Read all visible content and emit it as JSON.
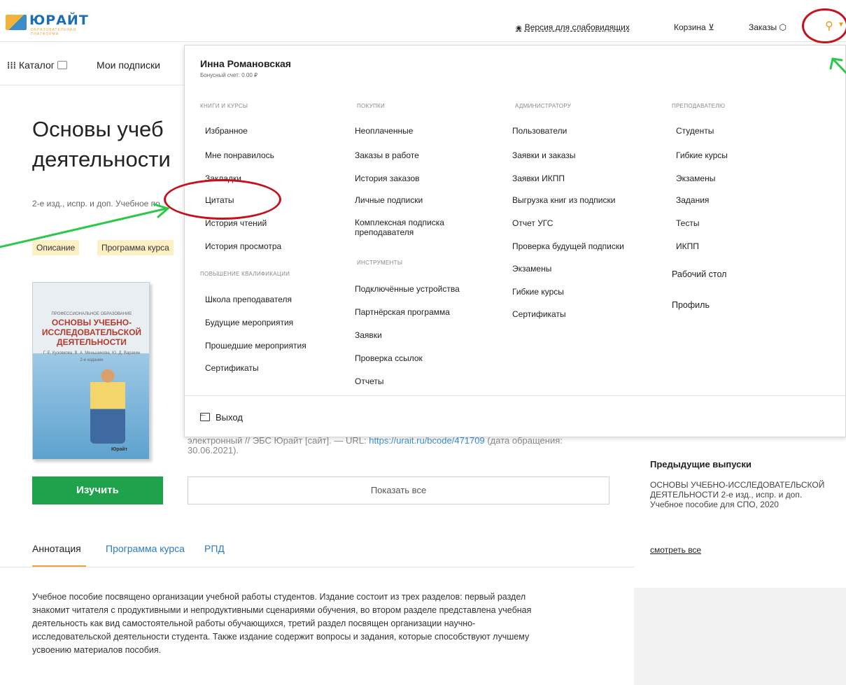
{
  "header": {
    "logo_text": "ЮРАЙТ",
    "logo_sub": "ОБРАЗОВАТЕЛЬНАЯ ПЛАТФОРМА",
    "accessible_version": "Версия для слабовидящих",
    "cart": "Корзина",
    "orders": "Заказы",
    "cart_icon": "🛒",
    "orders_icon": "⬡"
  },
  "nav": {
    "catalog": "Каталог",
    "subscriptions": "Мои подписки"
  },
  "book": {
    "title_line1": "Основы учеб",
    "title_line2": "деятельности",
    "edition": "2-е изд., испр. и доп. Учебное по",
    "tag_description": "Описание",
    "tag_program": "Программа курса",
    "cover_series": "ПРОФЕССИОНАЛЬНОЕ ОБРАЗОВАНИЕ",
    "cover_title": "ОСНОВЫ УЧЕБНО-ИССЛЕДОВАТЕЛЬСКОЙ ДЕЯТЕЛЬНОСТИ",
    "cover_authors": "Г. Е. Кузовкова, В. А. Меньшикова, Ю. Д. Варакин",
    "cover_edition": "2-е издание",
    "cover_publisher": "Юрайт",
    "citation_text": "электронный // ЭБС Юрайт [сайт]. — URL: ",
    "citation_url": "https://urait.ru/bcode/471709",
    "citation_tail": " (дата обращения: 30.06.2021).",
    "study_button": "Изучить",
    "show_all_button": "Показать все"
  },
  "tabs": {
    "annotation": "Аннотация",
    "program": "Программа курса",
    "rpd": "РПД"
  },
  "annotation_text": "Учебное пособие посвящено организации учебной работы студентов. Издание состоит из трех разделов: первый раздел знакомит читателя с продуктивными и непродуктивными сценариями обучения, во втором разделе представлена учебная деятельность как вид самостоятельной работы обучающихся, третий раздел посвящен организации научно-исследовательской деятельности студента. Также издание содержит вопросы и задания, которые способствуют лучшему усвоению материалов пособия.",
  "sidebar": {
    "previous_heading": "Предыдущие выпуски",
    "previous_text": "ОСНОВЫ УЧЕБНО-ИССЛЕДОВАТЕЛЬСКОЙ ДЕЯТЕЛЬНОСТИ 2-е изд., испр. и доп. Учебное пособие для СПО, 2020",
    "see_all": "смотреть все"
  },
  "dropdown": {
    "user_name": "Инна Романовская",
    "bonus": "Бонусный счет: 0.00 ₽",
    "logout": "Выход",
    "col_books": {
      "heading": "Книги и курсы",
      "items": [
        "Избранное",
        "Мне понравилось",
        "Закладки",
        "Цитаты",
        "История чтений",
        "История просмотра"
      ]
    },
    "col_qualification": {
      "heading": "Повышение квалификации",
      "items": [
        "Школа преподавателя",
        "Будущие мероприятия",
        "Прошедшие мероприятия",
        "Сертификаты"
      ]
    },
    "col_purchases": {
      "heading": "Покупки",
      "items": [
        "Неоплаченные",
        "Заказы в работе",
        "История заказов",
        "Личные подписки",
        "Комплексная подписка преподавателя"
      ]
    },
    "col_tools": {
      "heading": "Инструменты",
      "items": [
        "Подключённые устройства",
        "Партнёрская программа",
        "Заявки",
        "Проверка ссылок",
        "Отчеты"
      ]
    },
    "col_admin": {
      "heading": "Администратору",
      "items": [
        "Пользователи",
        "Заявки и заказы",
        "Заявки ИКПП",
        "Выгрузка книг из подписки",
        "Отчет УГС",
        "Проверка будущей подписки",
        "Экзамены",
        "Гибкие курсы",
        "Сертификаты"
      ]
    },
    "col_teacher": {
      "heading": "Преподавателю",
      "items": [
        "Студенты",
        "Гибкие курсы",
        "Экзамены",
        "Задания",
        "Тесты",
        "ИКПП"
      ],
      "extra": [
        "Рабочий стол",
        "Профиль"
      ]
    }
  },
  "colors": {
    "accent_orange": "#e9a43b",
    "green_button": "#1ea24b",
    "link_blue": "#2a7bc4",
    "annotation_red": "#c8101c",
    "annotation_green": "#2cc84a"
  }
}
